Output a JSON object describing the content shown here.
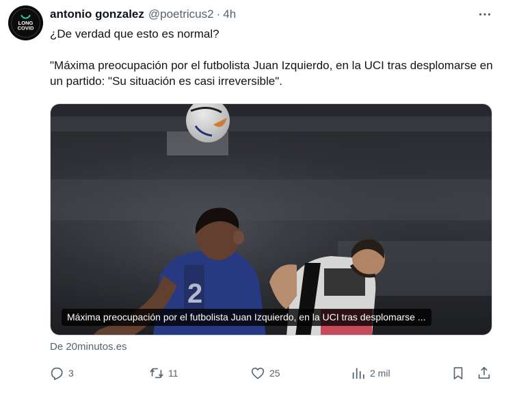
{
  "author": {
    "name": "antonio gonzalez",
    "handle": "@poetricus2",
    "separator": "·",
    "time": "4h",
    "avatar_text_1": "LONG",
    "avatar_text_2": "COVID"
  },
  "tweet": {
    "line1": "¿De verdad que esto es normal?",
    "line2": "\"Máxima preocupación por el futbolista Juan Izquierdo, en la UCI tras desplomarse en un partido: \"Su situación es casi irreversible\"."
  },
  "card": {
    "image_caption": "Máxima preocupación por el futbolista Juan Izquierdo, en la UCI tras desplomarse ...",
    "source": "De 20minutos.es"
  },
  "actions": {
    "replies": "3",
    "retweets": "11",
    "likes": "25",
    "views": "2 mil"
  },
  "icons": {
    "more": "more-horizontal-icon",
    "reply": "reply-icon",
    "retweet": "retweet-icon",
    "like": "heart-icon",
    "views": "analytics-icon",
    "bookmark": "bookmark-icon",
    "share": "share-icon"
  },
  "colors": {
    "text": "#0f1419",
    "secondary": "#536471",
    "border": "#cfd9de"
  }
}
